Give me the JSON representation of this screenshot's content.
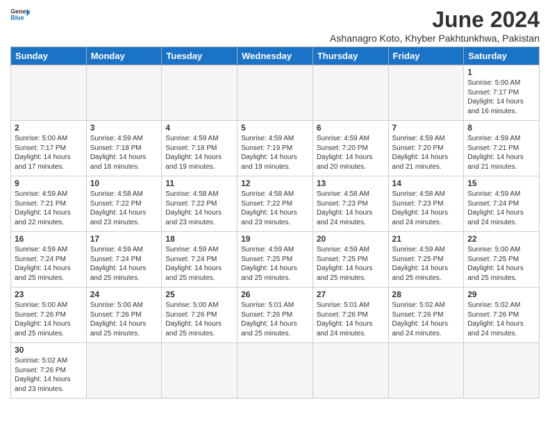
{
  "header": {
    "logo_general": "General",
    "logo_blue": "Blue",
    "title": "June 2024",
    "subtitle": "Ashanagro Koto, Khyber Pakhtunkhwa, Pakistan"
  },
  "weekdays": [
    "Sunday",
    "Monday",
    "Tuesday",
    "Wednesday",
    "Thursday",
    "Friday",
    "Saturday"
  ],
  "weeks": [
    [
      {
        "day": "",
        "info": ""
      },
      {
        "day": "",
        "info": ""
      },
      {
        "day": "",
        "info": ""
      },
      {
        "day": "",
        "info": ""
      },
      {
        "day": "",
        "info": ""
      },
      {
        "day": "",
        "info": ""
      },
      {
        "day": "1",
        "info": "Sunrise: 5:00 AM\nSunset: 7:17 PM\nDaylight: 14 hours\nand 16 minutes."
      }
    ],
    [
      {
        "day": "2",
        "info": "Sunrise: 5:00 AM\nSunset: 7:17 PM\nDaylight: 14 hours\nand 17 minutes."
      },
      {
        "day": "3",
        "info": "Sunrise: 4:59 AM\nSunset: 7:18 PM\nDaylight: 14 hours\nand 18 minutes."
      },
      {
        "day": "4",
        "info": "Sunrise: 4:59 AM\nSunset: 7:18 PM\nDaylight: 14 hours\nand 19 minutes."
      },
      {
        "day": "5",
        "info": "Sunrise: 4:59 AM\nSunset: 7:19 PM\nDaylight: 14 hours\nand 19 minutes."
      },
      {
        "day": "6",
        "info": "Sunrise: 4:59 AM\nSunset: 7:20 PM\nDaylight: 14 hours\nand 20 minutes."
      },
      {
        "day": "7",
        "info": "Sunrise: 4:59 AM\nSunset: 7:20 PM\nDaylight: 14 hours\nand 21 minutes."
      },
      {
        "day": "8",
        "info": "Sunrise: 4:59 AM\nSunset: 7:21 PM\nDaylight: 14 hours\nand 21 minutes."
      }
    ],
    [
      {
        "day": "9",
        "info": "Sunrise: 4:59 AM\nSunset: 7:21 PM\nDaylight: 14 hours\nand 22 minutes."
      },
      {
        "day": "10",
        "info": "Sunrise: 4:58 AM\nSunset: 7:22 PM\nDaylight: 14 hours\nand 23 minutes."
      },
      {
        "day": "11",
        "info": "Sunrise: 4:58 AM\nSunset: 7:22 PM\nDaylight: 14 hours\nand 23 minutes."
      },
      {
        "day": "12",
        "info": "Sunrise: 4:58 AM\nSunset: 7:22 PM\nDaylight: 14 hours\nand 23 minutes."
      },
      {
        "day": "13",
        "info": "Sunrise: 4:58 AM\nSunset: 7:23 PM\nDaylight: 14 hours\nand 24 minutes."
      },
      {
        "day": "14",
        "info": "Sunrise: 4:58 AM\nSunset: 7:23 PM\nDaylight: 14 hours\nand 24 minutes."
      },
      {
        "day": "15",
        "info": "Sunrise: 4:59 AM\nSunset: 7:24 PM\nDaylight: 14 hours\nand 24 minutes."
      }
    ],
    [
      {
        "day": "16",
        "info": "Sunrise: 4:59 AM\nSunset: 7:24 PM\nDaylight: 14 hours\nand 25 minutes."
      },
      {
        "day": "17",
        "info": "Sunrise: 4:59 AM\nSunset: 7:24 PM\nDaylight: 14 hours\nand 25 minutes."
      },
      {
        "day": "18",
        "info": "Sunrise: 4:59 AM\nSunset: 7:24 PM\nDaylight: 14 hours\nand 25 minutes."
      },
      {
        "day": "19",
        "info": "Sunrise: 4:59 AM\nSunset: 7:25 PM\nDaylight: 14 hours\nand 25 minutes."
      },
      {
        "day": "20",
        "info": "Sunrise: 4:59 AM\nSunset: 7:25 PM\nDaylight: 14 hours\nand 25 minutes."
      },
      {
        "day": "21",
        "info": "Sunrise: 4:59 AM\nSunset: 7:25 PM\nDaylight: 14 hours\nand 25 minutes."
      },
      {
        "day": "22",
        "info": "Sunrise: 5:00 AM\nSunset: 7:25 PM\nDaylight: 14 hours\nand 25 minutes."
      }
    ],
    [
      {
        "day": "23",
        "info": "Sunrise: 5:00 AM\nSunset: 7:26 PM\nDaylight: 14 hours\nand 25 minutes."
      },
      {
        "day": "24",
        "info": "Sunrise: 5:00 AM\nSunset: 7:26 PM\nDaylight: 14 hours\nand 25 minutes."
      },
      {
        "day": "25",
        "info": "Sunrise: 5:00 AM\nSunset: 7:26 PM\nDaylight: 14 hours\nand 25 minutes."
      },
      {
        "day": "26",
        "info": "Sunrise: 5:01 AM\nSunset: 7:26 PM\nDaylight: 14 hours\nand 25 minutes."
      },
      {
        "day": "27",
        "info": "Sunrise: 5:01 AM\nSunset: 7:26 PM\nDaylight: 14 hours\nand 24 minutes."
      },
      {
        "day": "28",
        "info": "Sunrise: 5:02 AM\nSunset: 7:26 PM\nDaylight: 14 hours\nand 24 minutes."
      },
      {
        "day": "29",
        "info": "Sunrise: 5:02 AM\nSunset: 7:26 PM\nDaylight: 14 hours\nand 24 minutes."
      }
    ],
    [
      {
        "day": "30",
        "info": "Sunrise: 5:02 AM\nSunset: 7:26 PM\nDaylight: 14 hours\nand 23 minutes."
      },
      {
        "day": "",
        "info": ""
      },
      {
        "day": "",
        "info": ""
      },
      {
        "day": "",
        "info": ""
      },
      {
        "day": "",
        "info": ""
      },
      {
        "day": "",
        "info": ""
      },
      {
        "day": "",
        "info": ""
      }
    ]
  ]
}
